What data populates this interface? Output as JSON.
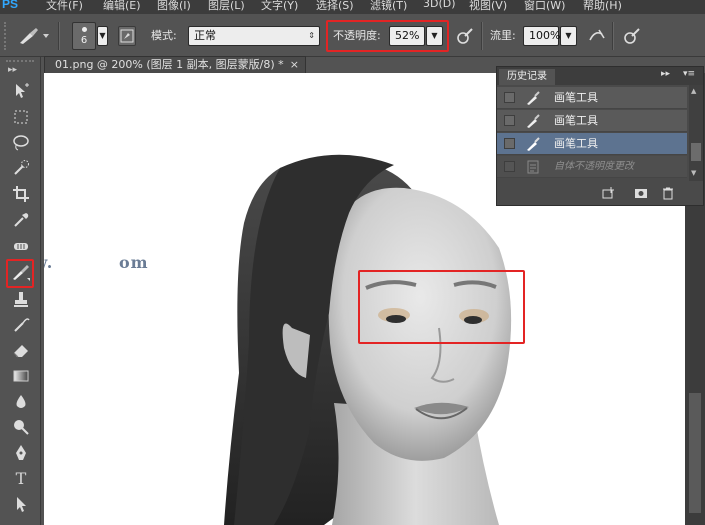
{
  "menubar": {
    "logo": "PS",
    "items": [
      "文件(F)",
      "编辑(E)",
      "图像(I)",
      "图层(L)",
      "文字(Y)",
      "选择(S)",
      "滤镜(T)",
      "3D(D)",
      "视图(V)",
      "窗口(W)",
      "帮助(H)"
    ]
  },
  "options": {
    "brush_size": "6",
    "mode_label": "模式:",
    "mode_value": "正常",
    "opacity_label": "不透明度:",
    "opacity_value": "52%",
    "flow_label": "流里:",
    "flow_value": "100%"
  },
  "document_tab": {
    "title": "01.png @ 200% (图层 1 副本, 图层蒙版/8) *",
    "close": "×"
  },
  "history_panel": {
    "tab_label": "历史记录",
    "collapse": "▸▸",
    "menu": "▾≡",
    "items": [
      {
        "label": "画笔工具",
        "state": "normal"
      },
      {
        "label": "画笔工具",
        "state": "normal"
      },
      {
        "label": "画笔工具",
        "state": "selected"
      },
      {
        "label": "自体不透明度更改",
        "state": "dimmed"
      }
    ]
  },
  "watermark": "www.          om",
  "colors": {
    "highlight": "#e32424",
    "selected_row": "#5d7390"
  }
}
